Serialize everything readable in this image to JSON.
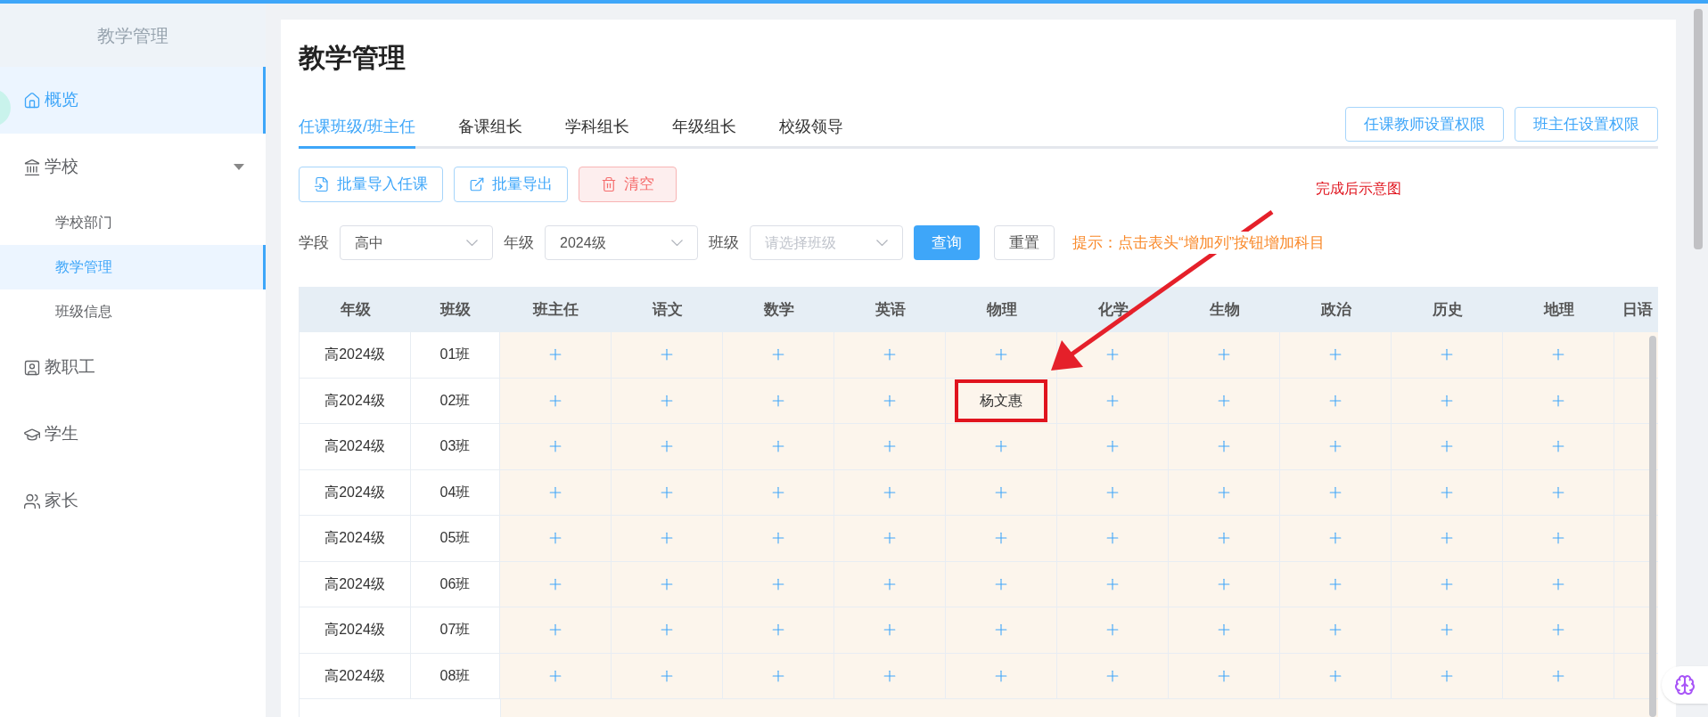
{
  "sidebar": {
    "title": "教学管理",
    "items": [
      {
        "label": "概览",
        "selected": true
      },
      {
        "label": "学校",
        "selected": false,
        "expanded": true,
        "children": [
          {
            "label": "学校部门",
            "selected": false
          },
          {
            "label": "教学管理",
            "selected": true
          },
          {
            "label": "班级信息",
            "selected": false
          }
        ]
      },
      {
        "label": "教职工",
        "selected": false
      },
      {
        "label": "学生",
        "selected": false
      },
      {
        "label": "家长",
        "selected": false
      }
    ]
  },
  "page_title": "教学管理",
  "tabs": [
    {
      "label": "任课班级/班主任",
      "selected": true
    },
    {
      "label": "备课组长",
      "selected": false
    },
    {
      "label": "学科组长",
      "selected": false
    },
    {
      "label": "年级组长",
      "selected": false
    },
    {
      "label": "校级领导",
      "selected": false
    }
  ],
  "header_buttons": [
    "任课教师设置权限",
    "班主任设置权限"
  ],
  "actions": [
    {
      "label": "批量导入任课",
      "kind": "import"
    },
    {
      "label": "批量导出",
      "kind": "export"
    },
    {
      "label": "清空",
      "kind": "danger"
    }
  ],
  "filters": [
    {
      "label": "学段",
      "value": "高中"
    },
    {
      "label": "年级",
      "value": "2024级"
    },
    {
      "label": "班级",
      "placeholder": "请选择班级"
    }
  ],
  "query_button": "查询",
  "reset_button": "重置",
  "tip": "提示：点击表头“增加列”按钮增加科目",
  "annotation": {
    "text": "完成后示意图"
  },
  "table": {
    "columns": [
      "年级",
      "班级",
      "班主任",
      "语文",
      "数学",
      "英语",
      "物理",
      "化学",
      "生物",
      "政治",
      "历史",
      "地理",
      "日语"
    ],
    "rows": [
      {
        "cells": [
          {
            "kind": "text",
            "text": "高2024级"
          },
          {
            "kind": "text",
            "text": "01班"
          },
          {
            "kind": "add"
          },
          {
            "kind": "add"
          },
          {
            "kind": "add"
          },
          {
            "kind": "add"
          },
          {
            "kind": "add"
          },
          {
            "kind": "add"
          },
          {
            "kind": "add"
          },
          {
            "kind": "add"
          },
          {
            "kind": "add"
          },
          {
            "kind": "add"
          }
        ]
      },
      {
        "cells": [
          {
            "kind": "text",
            "text": "高2024级"
          },
          {
            "kind": "text",
            "text": "02班"
          },
          {
            "kind": "add"
          },
          {
            "kind": "add"
          },
          {
            "kind": "add"
          },
          {
            "kind": "add"
          },
          {
            "kind": "name",
            "text": "杨文惠",
            "highlighted": true
          },
          {
            "kind": "add"
          },
          {
            "kind": "add"
          },
          {
            "kind": "add"
          },
          {
            "kind": "add"
          },
          {
            "kind": "add"
          }
        ]
      },
      {
        "cells": [
          {
            "kind": "text",
            "text": "高2024级"
          },
          {
            "kind": "text",
            "text": "03班"
          },
          {
            "kind": "add"
          },
          {
            "kind": "add"
          },
          {
            "kind": "add"
          },
          {
            "kind": "add"
          },
          {
            "kind": "add"
          },
          {
            "kind": "add"
          },
          {
            "kind": "add"
          },
          {
            "kind": "add"
          },
          {
            "kind": "add"
          },
          {
            "kind": "add"
          }
        ]
      },
      {
        "cells": [
          {
            "kind": "text",
            "text": "高2024级"
          },
          {
            "kind": "text",
            "text": "04班"
          },
          {
            "kind": "add"
          },
          {
            "kind": "add"
          },
          {
            "kind": "add"
          },
          {
            "kind": "add"
          },
          {
            "kind": "add"
          },
          {
            "kind": "add"
          },
          {
            "kind": "add"
          },
          {
            "kind": "add"
          },
          {
            "kind": "add"
          },
          {
            "kind": "add"
          }
        ]
      },
      {
        "cells": [
          {
            "kind": "text",
            "text": "高2024级"
          },
          {
            "kind": "text",
            "text": "05班"
          },
          {
            "kind": "add"
          },
          {
            "kind": "add"
          },
          {
            "kind": "add"
          },
          {
            "kind": "add"
          },
          {
            "kind": "add"
          },
          {
            "kind": "add"
          },
          {
            "kind": "add"
          },
          {
            "kind": "add"
          },
          {
            "kind": "add"
          },
          {
            "kind": "add"
          }
        ]
      },
      {
        "cells": [
          {
            "kind": "text",
            "text": "高2024级"
          },
          {
            "kind": "text",
            "text": "06班"
          },
          {
            "kind": "add"
          },
          {
            "kind": "add"
          },
          {
            "kind": "add"
          },
          {
            "kind": "add"
          },
          {
            "kind": "add"
          },
          {
            "kind": "add"
          },
          {
            "kind": "add"
          },
          {
            "kind": "add"
          },
          {
            "kind": "add"
          },
          {
            "kind": "add"
          }
        ]
      },
      {
        "cells": [
          {
            "kind": "text",
            "text": "高2024级"
          },
          {
            "kind": "text",
            "text": "07班"
          },
          {
            "kind": "add"
          },
          {
            "kind": "add"
          },
          {
            "kind": "add"
          },
          {
            "kind": "add"
          },
          {
            "kind": "add"
          },
          {
            "kind": "add"
          },
          {
            "kind": "add"
          },
          {
            "kind": "add"
          },
          {
            "kind": "add"
          },
          {
            "kind": "add"
          }
        ]
      },
      {
        "cells": [
          {
            "kind": "text",
            "text": "高2024级"
          },
          {
            "kind": "text",
            "text": "08班"
          },
          {
            "kind": "add"
          },
          {
            "kind": "add"
          },
          {
            "kind": "add"
          },
          {
            "kind": "add"
          },
          {
            "kind": "add"
          },
          {
            "kind": "add"
          },
          {
            "kind": "add"
          },
          {
            "kind": "add"
          },
          {
            "kind": "add"
          },
          {
            "kind": "add"
          }
        ]
      }
    ]
  }
}
